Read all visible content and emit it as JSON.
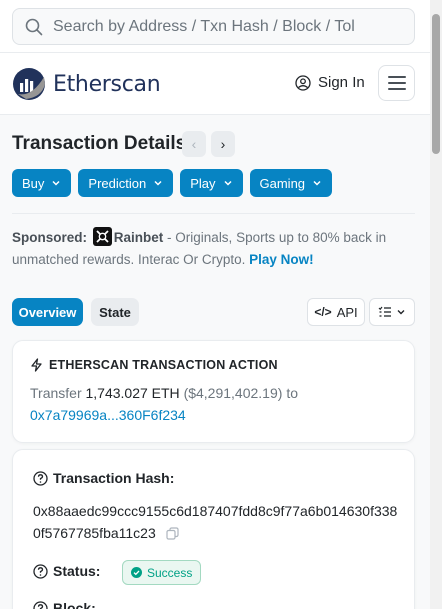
{
  "search": {
    "placeholder": "Search by Address / Txn Hash / Block / Tol"
  },
  "header": {
    "logo_text": "Etherscan",
    "signin_label": "Sign In"
  },
  "page": {
    "title": "Transaction Details",
    "prev_glyph": "‹",
    "next_glyph": "›"
  },
  "dropdowns": [
    {
      "label": "Buy"
    },
    {
      "label": "Prediction"
    },
    {
      "label": "Play"
    },
    {
      "label": "Gaming"
    }
  ],
  "sponsor": {
    "prefix": "Sponsored:",
    "name": "Rainbet",
    "text": " - Originals, Sports up to 80% back in unmatched rewards. Interac Or Crypto. ",
    "cta": "Play Now!"
  },
  "tabs": {
    "overview": "Overview",
    "state": "State"
  },
  "toolbar": {
    "api_code": "</>",
    "api_label": "API"
  },
  "action": {
    "heading": "ETHERSCAN TRANSACTION ACTION",
    "verb": "Transfer",
    "amount": "1,743.027 ETH",
    "usd": "($4,291,402.19)",
    "to": "to",
    "address": "0x7a79969a...360F6f234"
  },
  "details": {
    "hash_label": "Transaction Hash:",
    "hash_value": "0x88aaedc99ccc9155c6d187407fdd8c9f77a6b014630f3380f5767785fba11c23",
    "status_label": "Status:",
    "status_value": "Success",
    "block_label": "Block:"
  },
  "colors": {
    "accent": "#0784c3",
    "success": "#00a186",
    "brand_dark": "#21325b"
  }
}
